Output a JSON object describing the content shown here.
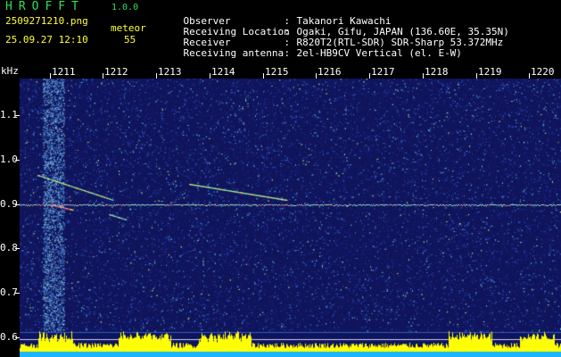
{
  "header": {
    "app_title": "HROFFT",
    "app_version": "1.0.0",
    "file_name": "2509271210.png",
    "timestamp": "25.09.27 12:10",
    "event_type": "meteor",
    "event_count": "55"
  },
  "station_info": [
    {
      "key": "Observer",
      "sep": ":",
      "value": "Takanori Kawachi"
    },
    {
      "key": "Receiving Location",
      "sep": ":",
      "value": "Ogaki, Gifu, JAPAN (136.60E, 35.35N)"
    },
    {
      "key": "Receiver",
      "sep": ":",
      "value": "R820T2(RTL-SDR) SDR-Sharp 53.372MHz"
    },
    {
      "key": "Receiving antenna",
      "sep": ":",
      "value": "2el-HB9CV Vertical (el. E-W)"
    }
  ],
  "axes": {
    "y_unit": "kHz",
    "x_ticks": [
      "1211",
      "1212",
      "1213",
      "1214",
      "1215",
      "1216",
      "1217",
      "1218",
      "1219",
      "1220"
    ],
    "y_ticks": [
      "1.1",
      "1.0",
      "0.9",
      "0.8",
      "0.7",
      "0.6"
    ]
  },
  "colors": {
    "background": "#000000",
    "spectrum_base": "#10145a",
    "title_green": "#2fe05a",
    "meta_yellow": "#ffff33",
    "power_bar": "#ffff00",
    "cyan_band": "#19b6ff"
  }
}
